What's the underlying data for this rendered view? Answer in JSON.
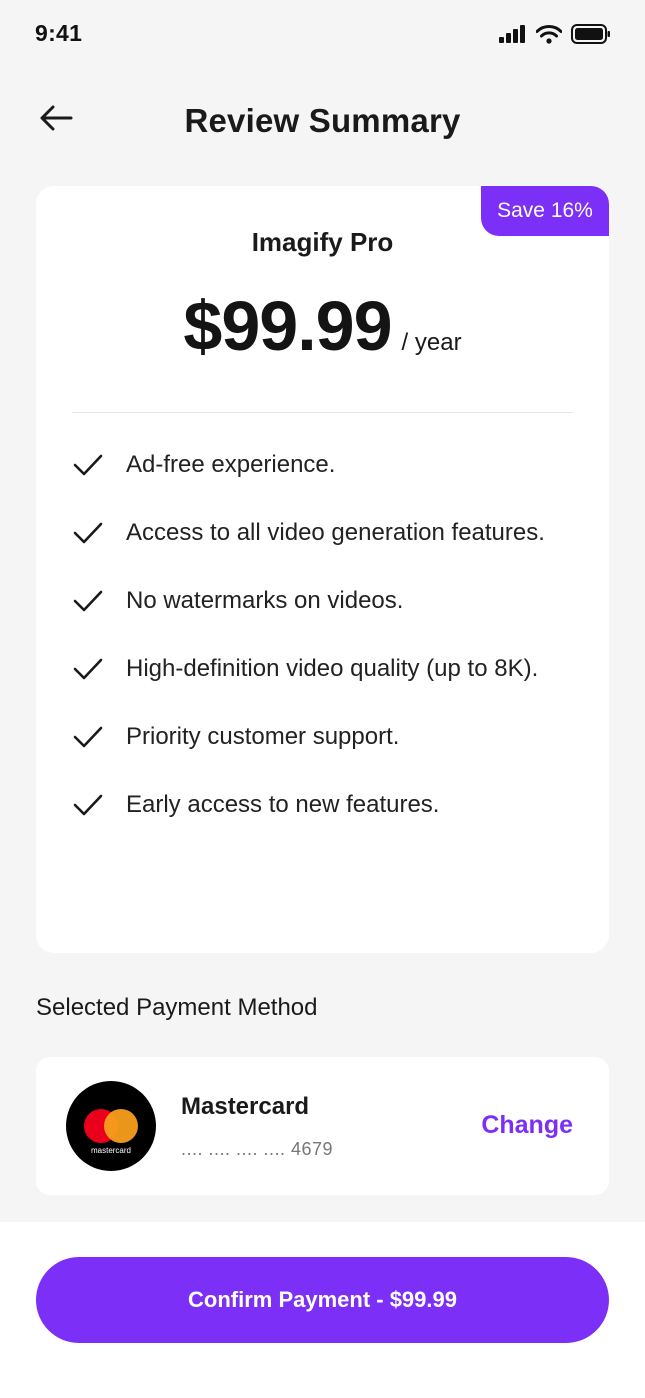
{
  "status_bar": {
    "time": "9:41",
    "icons": [
      "signal-icon",
      "wifi-icon",
      "battery-icon"
    ]
  },
  "header": {
    "title": "Review Summary",
    "back_icon": "arrow-left-icon"
  },
  "plan": {
    "badge": "Save 16%",
    "name": "Imagify Pro",
    "price": "$99.99",
    "period": "/ year",
    "features": [
      "Ad-free experience.",
      "Access to all video generation features.",
      "No watermarks on videos.",
      "High-definition video quality (up to 8K).",
      "Priority customer support.",
      "Early access to new features."
    ]
  },
  "payment": {
    "section_title": "Selected Payment Method",
    "card_brand": "Mastercard",
    "card_logo_text": "mastercard",
    "card_number": ".... .... .... .... 4679",
    "change_label": "Change"
  },
  "confirm": {
    "label": "Confirm Payment - $99.99"
  },
  "colors": {
    "accent": "#7b2ff7",
    "background": "#f5f5f5",
    "card": "#ffffff"
  }
}
